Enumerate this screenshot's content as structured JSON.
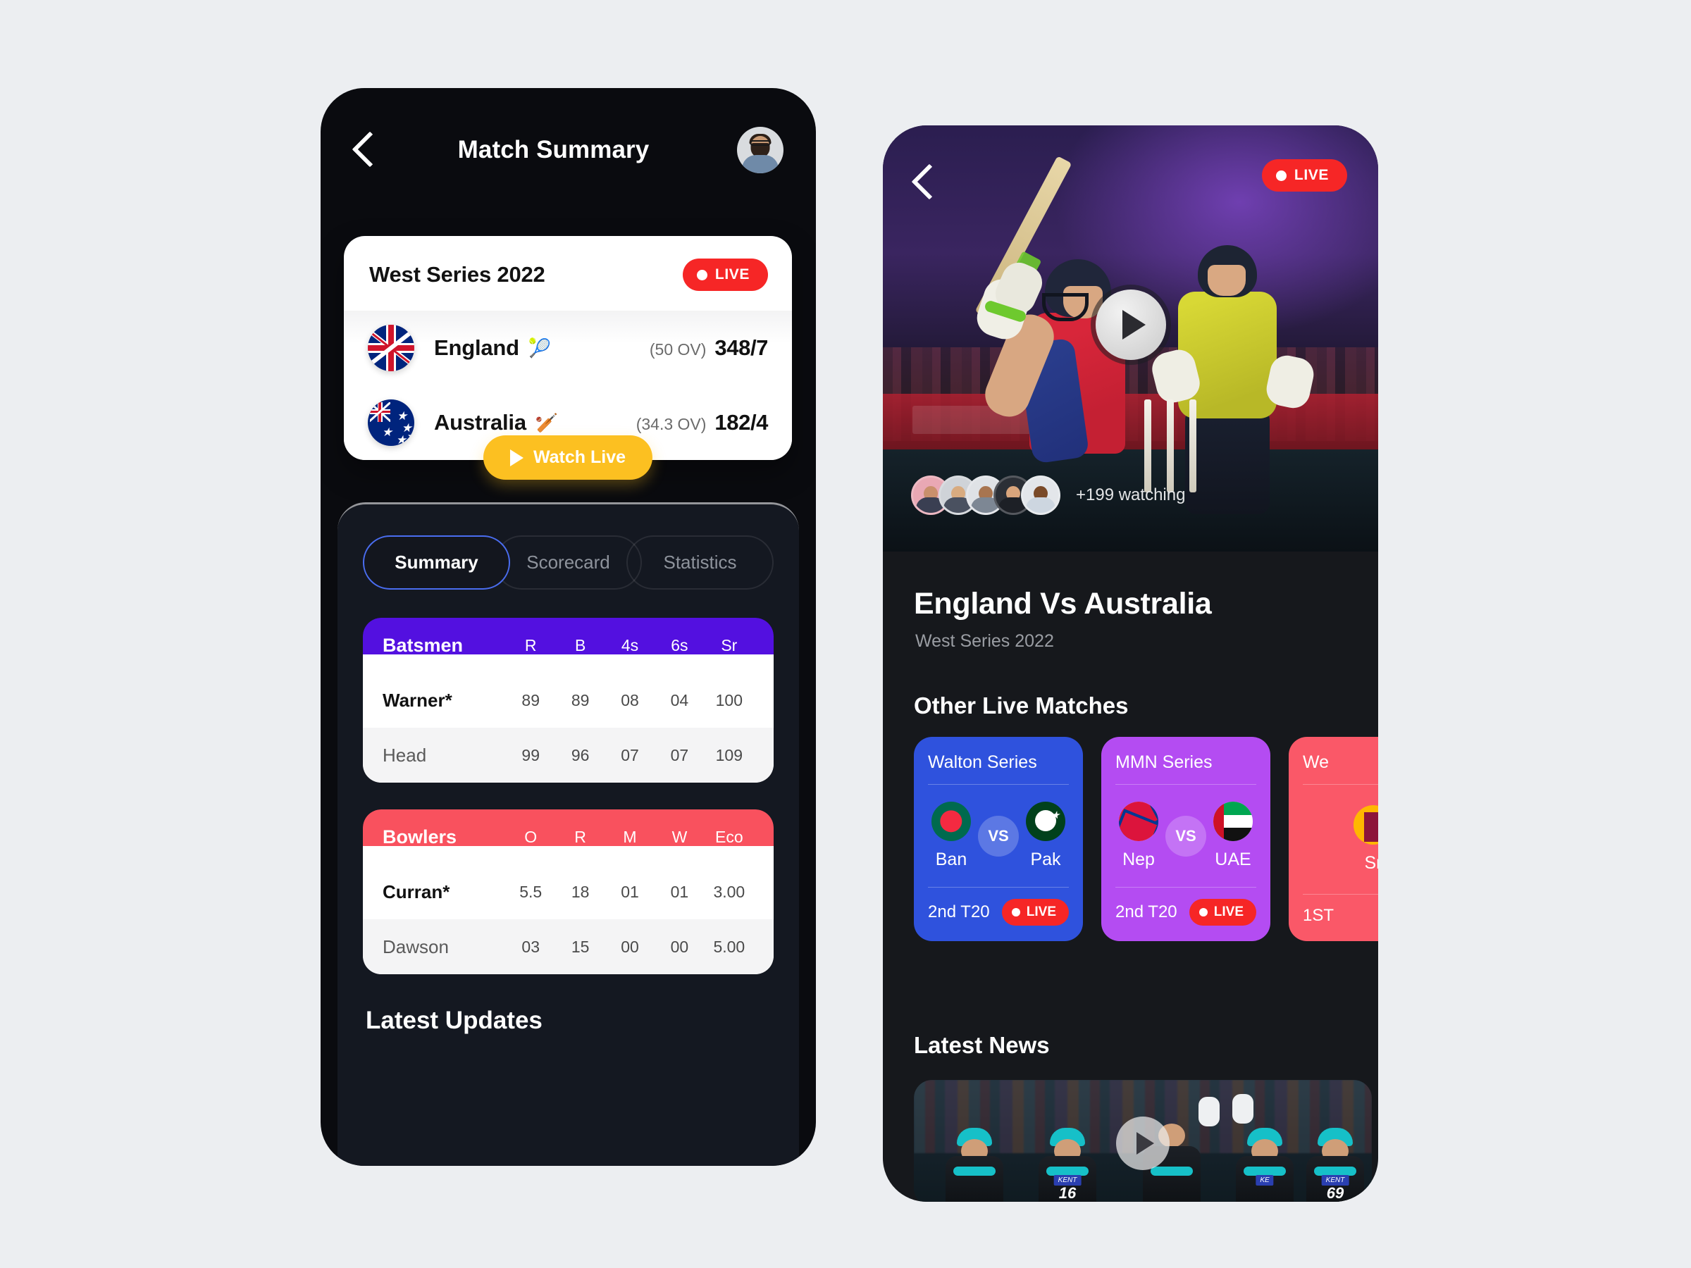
{
  "left": {
    "topbar": {
      "title": "Match Summary",
      "back_icon": "chevron-left-icon",
      "avatar": "user-avatar"
    },
    "score_card": {
      "series": "West Series 2022",
      "live_label": "LIVE",
      "teams": [
        {
          "name": "England",
          "emoji": "🎾",
          "emoji_name": "ball-icon",
          "overs": "(50 OV)",
          "score": "348/7",
          "flag": "uk-flag"
        },
        {
          "name": "Australia",
          "emoji": "🏏",
          "emoji_name": "bat-icon",
          "overs": "(34.3 OV)",
          "score": "182/4",
          "flag": "australia-flag"
        }
      ],
      "watch_button": "Watch Live"
    },
    "tabs": [
      {
        "label": "Summary",
        "active": true
      },
      {
        "label": "Scorecard",
        "active": false
      },
      {
        "label": "Statistics",
        "active": false
      }
    ],
    "batsmen_table": {
      "headers": [
        "Batsmen",
        "R",
        "B",
        "4s",
        "6s",
        "Sr"
      ],
      "rows": [
        {
          "name": "Warner*",
          "values": [
            "89",
            "89",
            "08",
            "04",
            "100"
          ]
        },
        {
          "name": "Head",
          "values": [
            "99",
            "96",
            "07",
            "07",
            "109"
          ]
        }
      ]
    },
    "bowlers_table": {
      "headers": [
        "Bowlers",
        "O",
        "R",
        "M",
        "W",
        "Eco"
      ],
      "rows": [
        {
          "name": "Curran*",
          "values": [
            "5.5",
            "18",
            "01",
            "01",
            "3.00"
          ]
        },
        {
          "name": "Dawson",
          "values": [
            "03",
            "15",
            "00",
            "00",
            "5.00"
          ]
        }
      ]
    },
    "latest_updates": "Latest Updates"
  },
  "right": {
    "hero": {
      "back_icon": "chevron-left-icon",
      "live_label": "LIVE",
      "play_icon": "play-icon",
      "watching": "+199 watching"
    },
    "match_title": "England Vs Australia",
    "match_series": "West Series 2022",
    "other_matches_heading": "Other Live Matches",
    "matches": [
      {
        "series": "Walton Series",
        "home": "Ban",
        "away": "Pak",
        "vs": "VS",
        "stage": "2nd T20",
        "live": "LIVE",
        "color": "#2f52dd",
        "home_flag": "bangladesh-flag",
        "away_flag": "pakistan-flag"
      },
      {
        "series": "MMN Series",
        "home": "Nep",
        "away": "UAE",
        "vs": "VS",
        "stage": "2nd T20",
        "live": "LIVE",
        "color": "#b44cf2",
        "home_flag": "nepal-flag",
        "away_flag": "uae-flag"
      },
      {
        "series": "We",
        "home": "Sr",
        "away": "",
        "vs": "",
        "stage": "1ST",
        "live": "",
        "color": "#fa5868",
        "home_flag": "srilanka-flag",
        "away_flag": ""
      }
    ],
    "latest_news_heading": "Latest News",
    "news_play_icon": "play-icon"
  },
  "colors": {
    "accent_purple": "#5310e0",
    "accent_red": "#f9515e",
    "live_red": "#f62626",
    "watch_yellow": "#fcc021",
    "tab_active_border": "#4a6df0"
  }
}
